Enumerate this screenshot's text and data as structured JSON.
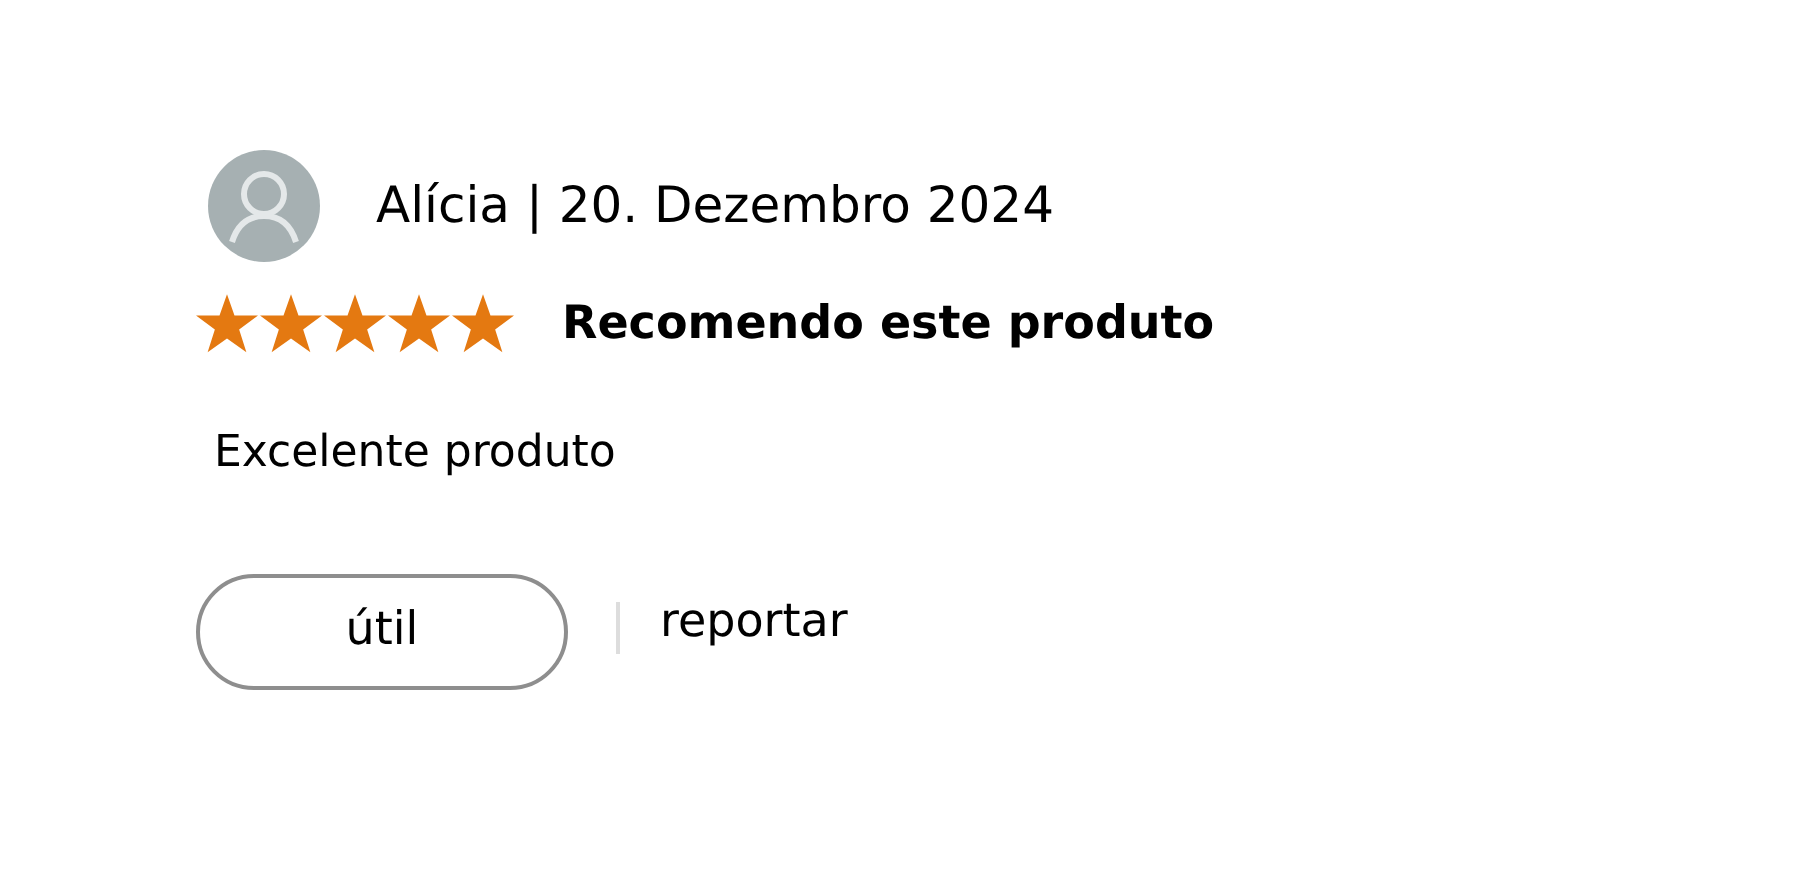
{
  "review": {
    "author_line": "Alícia | 20. Dezembro 2024",
    "stars": 5,
    "headline": "Recomendo este produto",
    "body": "Excelente produto",
    "helpful_button": "útil",
    "report_link": "reportar"
  }
}
